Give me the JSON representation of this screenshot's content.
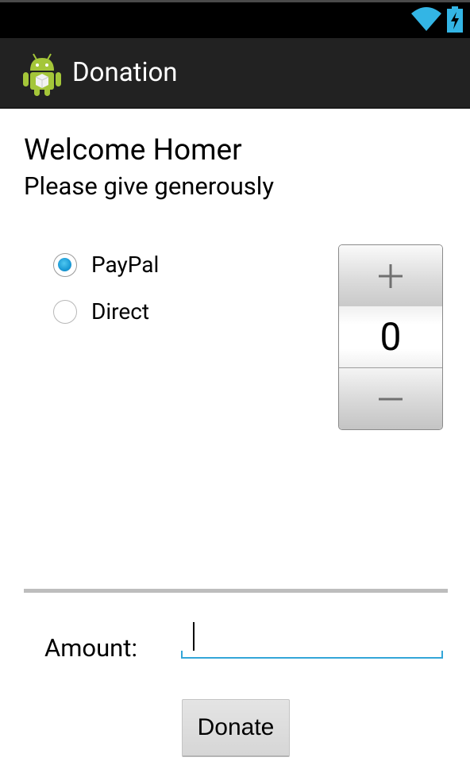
{
  "action_bar": {
    "title": "Donation",
    "icon": "android-robot-icon"
  },
  "status_bar": {
    "icons": [
      "wifi-icon",
      "battery-charging-icon"
    ],
    "accent": "#33b5e5"
  },
  "content": {
    "welcome": "Welcome Homer",
    "subtitle": "Please give generously"
  },
  "payment_methods": {
    "options": [
      {
        "label": "PayPal",
        "checked": true
      },
      {
        "label": "Direct",
        "checked": false
      }
    ]
  },
  "picker": {
    "value": "0",
    "increment_icon": "plus-icon",
    "decrement_icon": "minus-icon"
  },
  "amount": {
    "label": "Amount:",
    "value": "",
    "placeholder": ""
  },
  "donate_button": {
    "label": "Donate"
  },
  "colors": {
    "action_bar_bg": "#222222",
    "status_bar_bg": "#000000",
    "radio_checked": "#1a9ad6",
    "input_underline": "#33a6d8"
  }
}
